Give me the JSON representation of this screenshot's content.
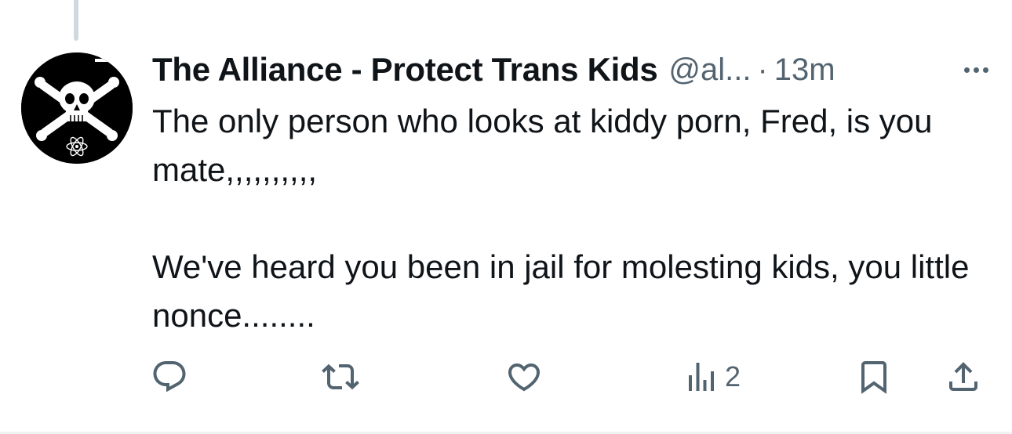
{
  "tweet": {
    "display_name": "The Alliance - Protect Trans Kids",
    "handle": "@al...",
    "separator": "·",
    "time": "13m",
    "text": "The only person who looks at kiddy porn, Fred, is you mate,,,,,,,,,,\n\nWe've heard you been in jail for molesting kids, you little nonce........",
    "avatar_icon": "skull-crossbones-avatar",
    "more_icon": "more-options-icon"
  },
  "actions": {
    "reply_icon": "reply-icon",
    "retweet_icon": "retweet-icon",
    "like_icon": "like-heart-icon",
    "views_icon": "views-chart-icon",
    "views_count": "2",
    "bookmark_icon": "bookmark-icon",
    "share_icon": "share-icon"
  },
  "colors": {
    "text_primary": "#0f1419",
    "text_secondary": "#536471",
    "thread_line": "#cfd9de",
    "divider": "#eff3f4"
  }
}
